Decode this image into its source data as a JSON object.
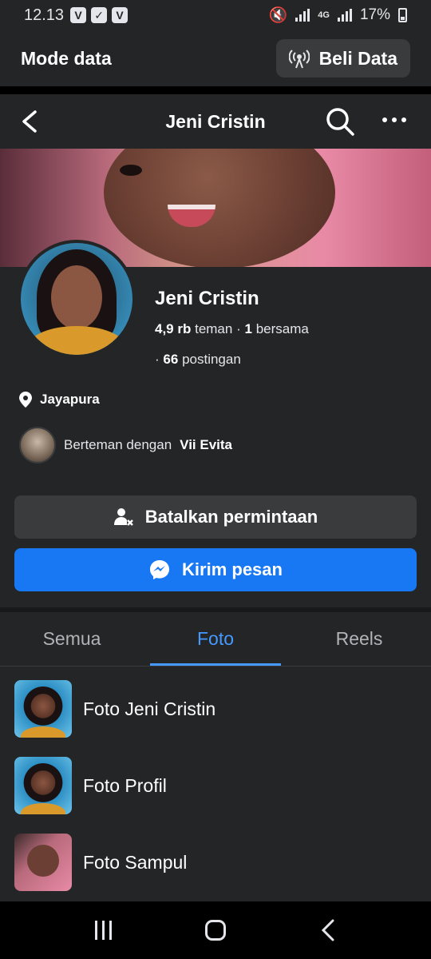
{
  "status_bar": {
    "time": "12.13",
    "battery": "17%",
    "network_label": "4G"
  },
  "data_bar": {
    "mode_label": "Mode data",
    "buy_label": "Beli Data"
  },
  "nav": {
    "title": "Jeni Cristin"
  },
  "profile": {
    "name": "Jeni Cristin",
    "friends_count": "4,9 rb",
    "friends_label": "teman",
    "mutual_sep": "·",
    "mutual_count": "1",
    "mutual_label": "bersama",
    "posts_sep": "·",
    "posts_count": "66",
    "posts_label": "postingan",
    "location": "Jayapura",
    "friends_with_prefix": "Berteman dengan",
    "friends_with_name": "Vii Evita",
    "cancel_button": "Batalkan permintaan",
    "message_button": "Kirim pesan"
  },
  "tabs": [
    {
      "label": "Semua",
      "active": false
    },
    {
      "label": "Foto",
      "active": true
    },
    {
      "label": "Reels",
      "active": false
    }
  ],
  "albums": [
    {
      "label": "Foto Jeni Cristin"
    },
    {
      "label": "Foto Profil"
    },
    {
      "label": "Foto Sampul"
    }
  ],
  "colors": {
    "accent": "#1877f2",
    "tab_active": "#4599ff",
    "background": "#242526"
  }
}
